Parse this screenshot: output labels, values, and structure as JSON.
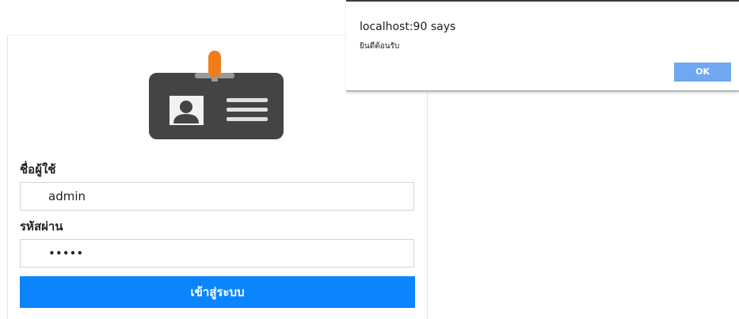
{
  "login": {
    "username_label": "ชื่อผู้ใช้",
    "username_value": "admin",
    "password_label": "รหัสผ่าน",
    "password_value": "admin",
    "submit_label": "เข้าสู่ระบบ",
    "accent_color": "#0a85fd"
  },
  "alert": {
    "title": "localhost:90 says",
    "message": "ยินดีต้อนรับ",
    "ok_label": "OK",
    "ok_color": "#6fa7f0"
  },
  "icons": {
    "badge": "id-card-icon"
  }
}
